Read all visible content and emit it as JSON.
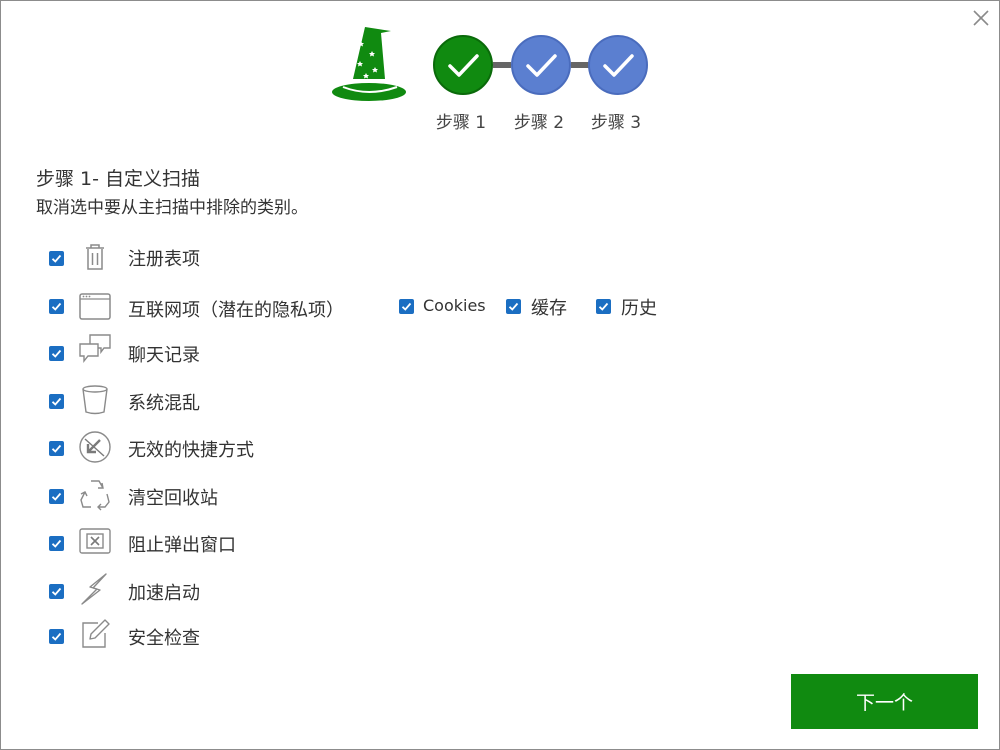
{
  "window": {
    "close_icon": "close-x-icon"
  },
  "wizard": {
    "icon": "wizard-hat-icon",
    "steps": [
      {
        "label": "步骤 1",
        "state": "completed",
        "color": "#108a10"
      },
      {
        "label": "步骤 2",
        "state": "completed",
        "color": "#5b7fd0"
      },
      {
        "label": "步骤 3",
        "state": "completed",
        "color": "#5b7fd0"
      }
    ]
  },
  "section": {
    "title": "步骤 1- 自定义扫描",
    "description": "取消选中要从主扫描中排除的类别。"
  },
  "items": [
    {
      "label": "注册表项",
      "icon": "trash-can-icon",
      "checked": true
    },
    {
      "label": "互联网项（潜在的隐私项）",
      "icon": "browser-window-icon",
      "checked": true,
      "sub_options": [
        {
          "label": "Cookies",
          "checked": true
        },
        {
          "label": "缓存",
          "checked": true
        },
        {
          "label": "历史",
          "checked": true
        }
      ]
    },
    {
      "label": "聊天记录",
      "icon": "chat-bubbles-icon",
      "checked": true
    },
    {
      "label": "系统混乱",
      "icon": "bin-icon",
      "checked": true
    },
    {
      "label": "无效的快捷方式",
      "icon": "broken-shortcut-icon",
      "checked": true
    },
    {
      "label": "清空回收站",
      "icon": "recycle-icon",
      "checked": true
    },
    {
      "label": "阻止弹出窗口",
      "icon": "blocked-popup-icon",
      "checked": true
    },
    {
      "label": "加速启动",
      "icon": "lightning-icon",
      "checked": true
    },
    {
      "label": "安全检查",
      "icon": "edit-check-icon",
      "checked": true
    }
  ],
  "footer": {
    "next_label": "下一个"
  },
  "colors": {
    "accent_green": "#108a10",
    "step_blue": "#5b7fd0",
    "checkbox_blue": "#1b6ec2"
  }
}
